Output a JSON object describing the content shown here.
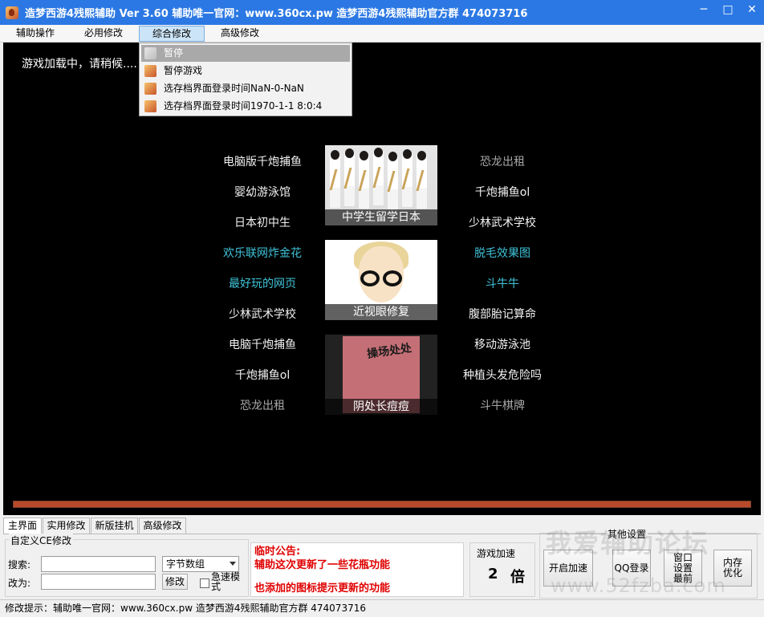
{
  "window": {
    "title": "造梦西游4残熙辅助 Ver 3.60      辅助唯一官网：www.360cx.pw    造梦西游4残熙辅助官方群 474073716",
    "controls": {
      "minimize": "─",
      "maximize": "□",
      "close": "✕"
    }
  },
  "menubar": {
    "items": [
      "辅助操作",
      "必用修改",
      "综合修改",
      "高级修改"
    ]
  },
  "dropdown": {
    "items": [
      "暂停",
      "暂停游戏",
      "选存档界面登录时间NaN-0-NaN",
      "选存档界面登录时间1970-1-1 8:0:4"
    ]
  },
  "game": {
    "loading": "游戏加载中，请稍候....",
    "left_links": [
      "电脑版千炮捕鱼",
      "婴幼游泳馆",
      "日本初中生",
      "欢乐联网炸金花",
      "最好玩的网页",
      "少林武术学校",
      "电脑千炮捕鱼",
      "千炮捕鱼ol",
      "恐龙出租"
    ],
    "right_links": [
      "恐龙出租",
      "千炮捕鱼ol",
      "少林武术学校",
      "脱毛效果图",
      "斗牛牛",
      "腹部胎记算命",
      "移动游泳池",
      "种植头发危险吗",
      "斗牛棋牌"
    ],
    "thumbs": [
      "中学生留学日本",
      "近视眼修复",
      "阴处长痘痘"
    ],
    "book_title": "操场处处"
  },
  "tabs": [
    "主界面",
    "实用修改",
    "新版挂机",
    "高级修改"
  ],
  "ce": {
    "group_title": "自定义CE修改",
    "search_label": "搜索:",
    "change_label": "改为:",
    "search_value": "",
    "change_value": "",
    "type_select": "字节数组",
    "modify_button": "修改",
    "fast_mode": "急速模式"
  },
  "notice": {
    "title": "临时公告:",
    "line1": "辅助这次更新了一些花瓶功能",
    "line2": "也添加的图标提示更新的功能"
  },
  "speed": {
    "title": "游戏加速",
    "value": "2",
    "unit": "倍"
  },
  "other": {
    "title": "其他设置",
    "buttons": [
      "开启加速",
      "QQ登录",
      "窗口设置最前",
      "内存优化"
    ]
  },
  "watermark": {
    "text": "我爱辅助论坛",
    "url": "www.52fzba.com"
  },
  "status": {
    "text": "修改提示：辅助唯一官网：www.360cx.pw    造梦西游4残熙辅助官方群 474073716"
  }
}
